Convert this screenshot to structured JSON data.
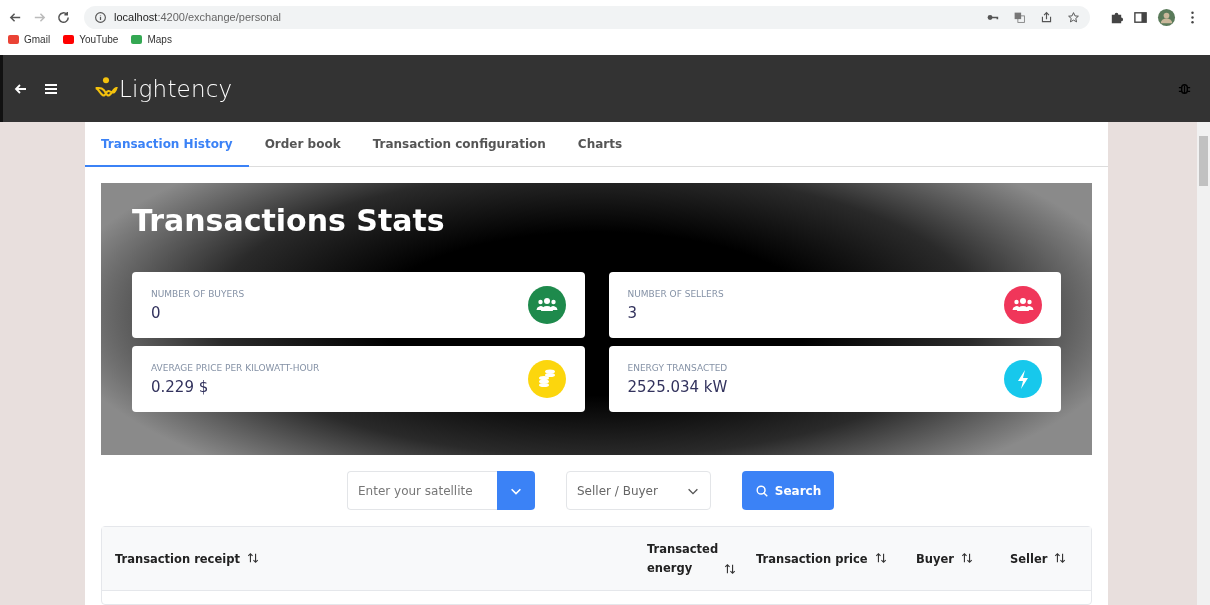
{
  "browser": {
    "url_host": "localhost",
    "url_path": ":4200/exchange/personal",
    "bookmarks": [
      {
        "label": "Gmail",
        "color": "#ea4335"
      },
      {
        "label": "YouTube",
        "color": "#ff0000"
      },
      {
        "label": "Maps",
        "color": "#34a853"
      }
    ]
  },
  "app": {
    "logo": "Lightency"
  },
  "tabs": [
    {
      "label": "Transaction History",
      "selected": true
    },
    {
      "label": "Order book",
      "selected": false
    },
    {
      "label": "Transaction configuration",
      "selected": false
    },
    {
      "label": "Charts",
      "selected": false
    }
  ],
  "stats": {
    "title": "Transactions Stats",
    "cards": [
      {
        "label": "NUMBER OF BUYERS",
        "value": "0",
        "color": "#1e8a4c"
      },
      {
        "label": "NUMBER OF SELLERS",
        "value": "3",
        "color": "#f0365a"
      },
      {
        "label": "AVERAGE PRICE PER KILOWATT-HOUR",
        "value": "0.229 $",
        "color": "#fcd60d"
      },
      {
        "label": "ENERGY TRANSACTED",
        "value": "2525.034 kW",
        "color": "#17c8ec"
      }
    ]
  },
  "filters": {
    "satellite": {
      "placeholder": "Enter your satellite"
    },
    "role": {
      "value": "Seller / Buyer"
    },
    "search_button": "Search"
  },
  "table": {
    "columns": [
      "Transaction receipt",
      "Transacted energy",
      "Transaction price",
      "Buyer",
      "Seller"
    ]
  }
}
